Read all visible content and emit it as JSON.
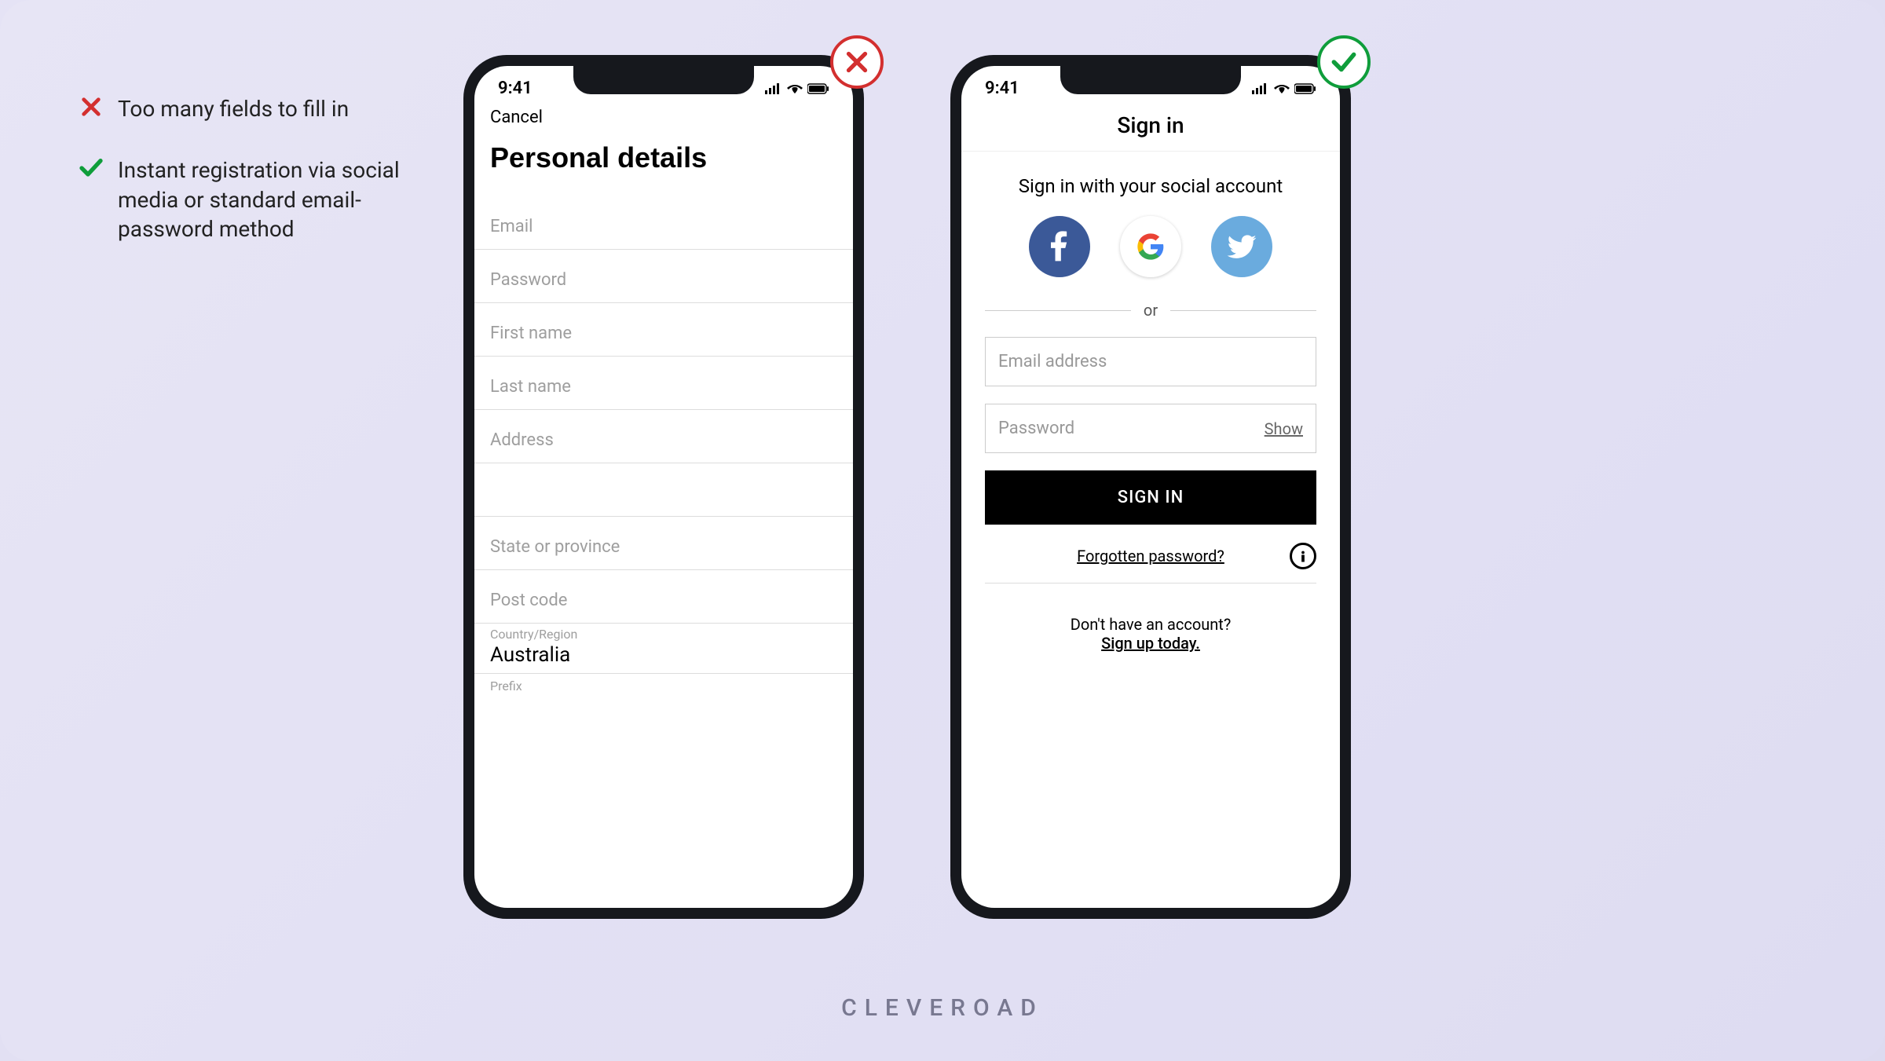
{
  "annotations": {
    "bad": "Too many fields to fill in",
    "good": "Instant registration via social media or standard email-password method"
  },
  "statusBar": {
    "time": "9:41"
  },
  "phone1": {
    "cancel": "Cancel",
    "title": "Personal details",
    "fields": {
      "email": "Email",
      "password": "Password",
      "firstName": "First name",
      "lastName": "Last name",
      "address": "Address",
      "state": "State or province",
      "postCode": "Post code",
      "countryLabel": "Country/Region",
      "countryValue": "Australia",
      "prefix": "Prefix"
    }
  },
  "phone2": {
    "title": "Sign in",
    "socialText": "Sign in with your social account",
    "divider": "or",
    "emailPlaceholder": "Email address",
    "passwordPlaceholder": "Password",
    "showLabel": "Show",
    "signInButton": "SIGN IN",
    "forgot": "Forgotten password?",
    "noAccount": "Don't have an account?",
    "signUp": "Sign up today."
  },
  "brand": "CLEVEROAD"
}
